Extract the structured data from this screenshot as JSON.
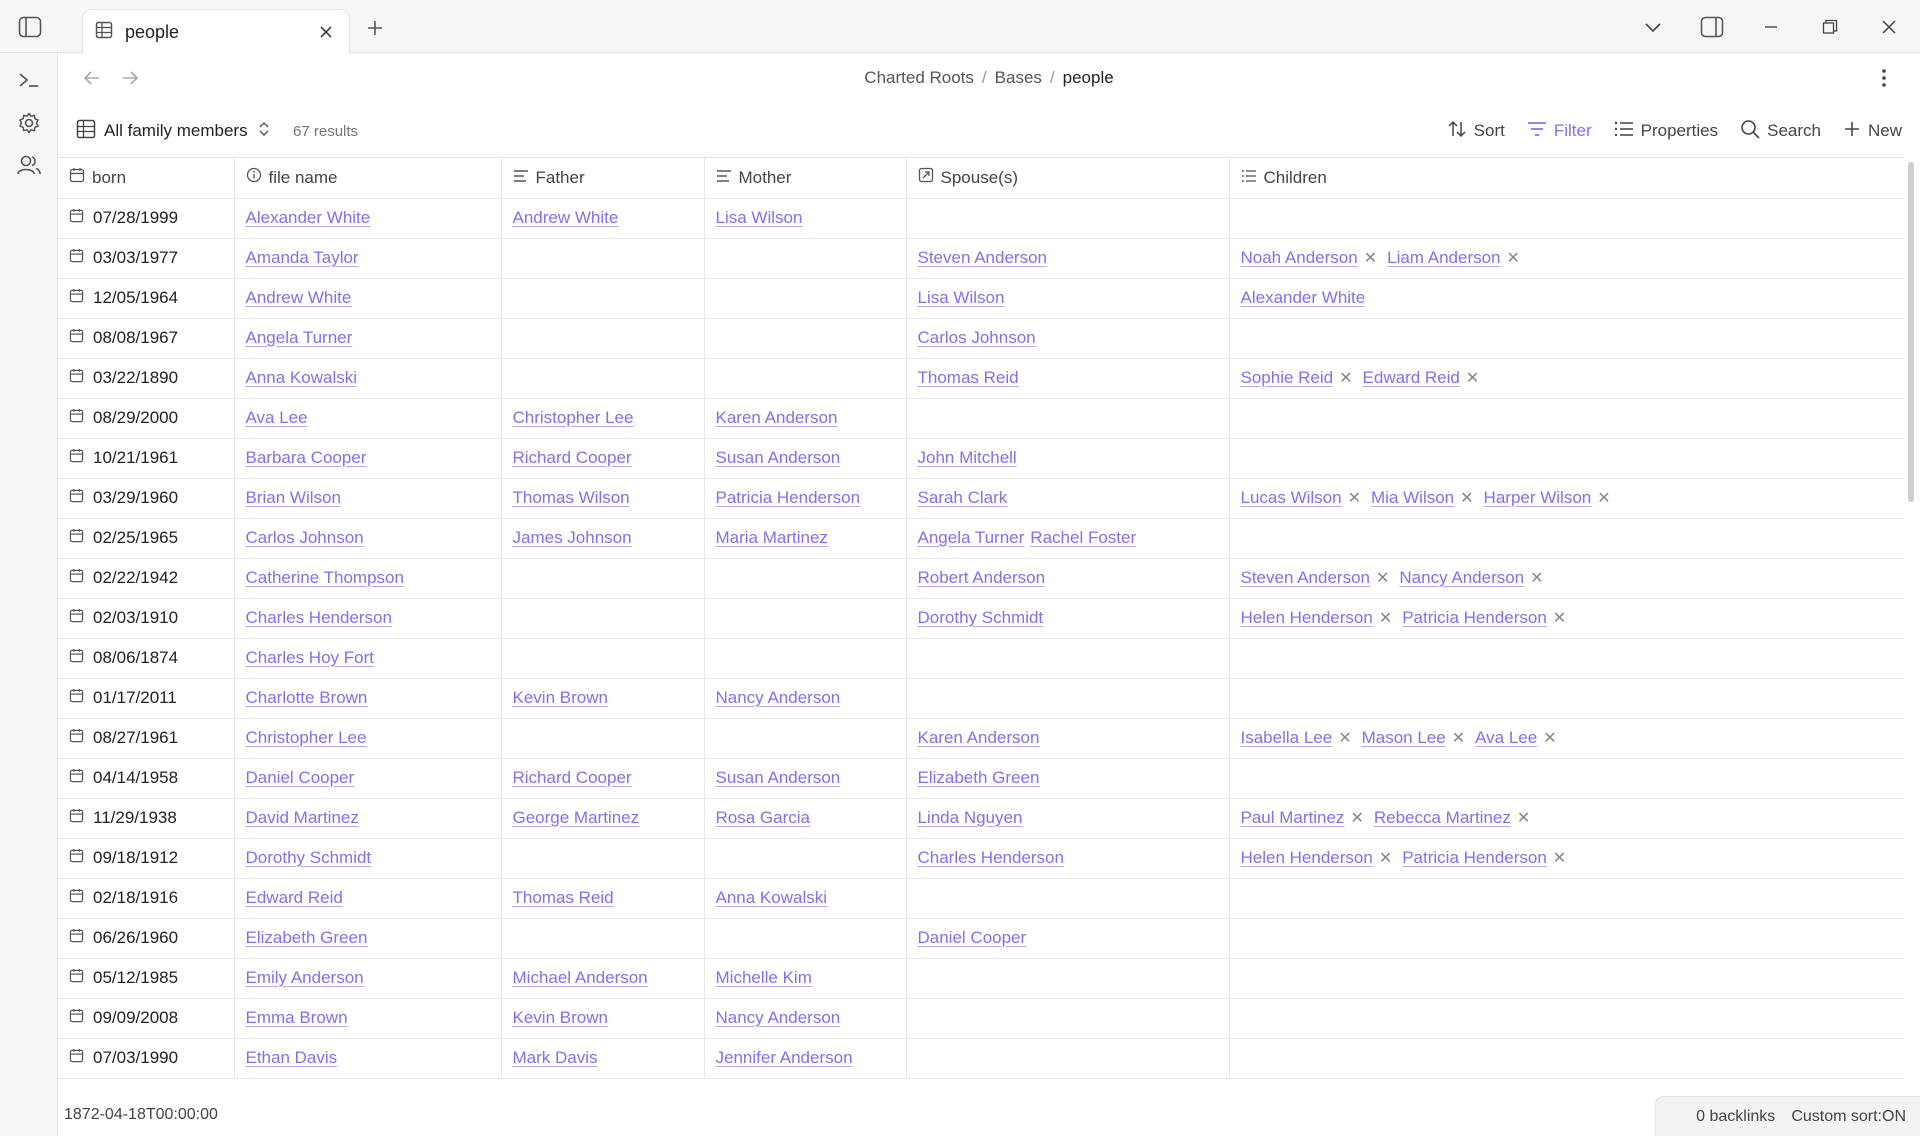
{
  "tab": {
    "label": "people"
  },
  "breadcrumb": {
    "items": [
      "Charted Roots",
      "Bases"
    ],
    "current": "people"
  },
  "toolbar": {
    "view_label": "All family members",
    "result_count": "67 results",
    "sort": "Sort",
    "filter": "Filter",
    "properties": "Properties",
    "search": "Search",
    "new": "New"
  },
  "columns": {
    "born": "born",
    "file_name": "file name",
    "father": "Father",
    "mother": "Mother",
    "spouses": "Spouse(s)",
    "children": "Children"
  },
  "rows": [
    {
      "born": "07/28/1999",
      "name": "Alexander White",
      "father": "Andrew White",
      "mother": "Lisa Wilson",
      "spouses": [],
      "children": []
    },
    {
      "born": "03/03/1977",
      "name": "Amanda Taylor",
      "father": "",
      "mother": "",
      "spouses": [
        "Steven Anderson"
      ],
      "children": [
        "Noah Anderson",
        "Liam Anderson"
      ]
    },
    {
      "born": "12/05/1964",
      "name": "Andrew White",
      "father": "",
      "mother": "",
      "spouses": [
        "Lisa Wilson"
      ],
      "children": [
        "Alexander White"
      ],
      "children_plain": true
    },
    {
      "born": "08/08/1967",
      "name": "Angela Turner",
      "father": "",
      "mother": "",
      "spouses": [
        "Carlos Johnson"
      ],
      "children": []
    },
    {
      "born": "03/22/1890",
      "name": "Anna Kowalski",
      "father": "",
      "mother": "",
      "spouses": [
        "Thomas Reid"
      ],
      "children": [
        "Sophie Reid",
        "Edward Reid"
      ]
    },
    {
      "born": "08/29/2000",
      "name": "Ava Lee",
      "father": "Christopher Lee",
      "mother": "Karen Anderson",
      "spouses": [],
      "children": []
    },
    {
      "born": "10/21/1961",
      "name": "Barbara Cooper",
      "father": "Richard Cooper",
      "mother": "Susan Anderson",
      "spouses": [
        "John Mitchell"
      ],
      "children": []
    },
    {
      "born": "03/29/1960",
      "name": "Brian Wilson",
      "father": "Thomas Wilson",
      "mother": "Patricia Henderson",
      "spouses": [
        "Sarah Clark"
      ],
      "children": [
        "Lucas Wilson",
        "Mia Wilson",
        "Harper Wilson"
      ]
    },
    {
      "born": "02/25/1965",
      "name": "Carlos Johnson",
      "father": "James Johnson",
      "mother": "Maria Martinez",
      "spouses": [
        "Angela Turner",
        "Rachel Foster"
      ],
      "children": []
    },
    {
      "born": "02/22/1942",
      "name": "Catherine Thompson",
      "father": "",
      "mother": "",
      "spouses": [
        "Robert Anderson"
      ],
      "children": [
        "Steven Anderson",
        "Nancy Anderson"
      ]
    },
    {
      "born": "02/03/1910",
      "name": "Charles Henderson",
      "father": "",
      "mother": "",
      "spouses": [
        "Dorothy Schmidt"
      ],
      "children": [
        "Helen Henderson",
        "Patricia Henderson"
      ]
    },
    {
      "born": "08/06/1874",
      "name": "Charles Hoy Fort",
      "father": "",
      "mother": "",
      "spouses": [],
      "children": []
    },
    {
      "born": "01/17/2011",
      "name": "Charlotte Brown",
      "father": "Kevin Brown",
      "mother": "Nancy Anderson",
      "spouses": [],
      "children": []
    },
    {
      "born": "08/27/1961",
      "name": "Christopher Lee",
      "father": "",
      "mother": "",
      "spouses": [
        "Karen Anderson"
      ],
      "children": [
        "Isabella Lee",
        "Mason Lee",
        "Ava Lee"
      ]
    },
    {
      "born": "04/14/1958",
      "name": "Daniel Cooper",
      "father": "Richard Cooper",
      "mother": "Susan Anderson",
      "spouses": [
        "Elizabeth Green"
      ],
      "children": []
    },
    {
      "born": "11/29/1938",
      "name": "David Martinez",
      "father": "George Martinez",
      "mother": "Rosa Garcia",
      "spouses": [
        "Linda Nguyen"
      ],
      "children": [
        "Paul Martinez",
        "Rebecca Martinez"
      ]
    },
    {
      "born": "09/18/1912",
      "name": "Dorothy Schmidt",
      "father": "",
      "mother": "",
      "spouses": [
        "Charles Henderson"
      ],
      "children": [
        "Helen Henderson",
        "Patricia Henderson"
      ]
    },
    {
      "born": "02/18/1916",
      "name": "Edward Reid",
      "father": "Thomas Reid",
      "mother": "Anna Kowalski",
      "spouses": [],
      "children": []
    },
    {
      "born": "06/26/1960",
      "name": "Elizabeth Green",
      "father": "",
      "mother": "",
      "spouses": [
        "Daniel Cooper"
      ],
      "children": []
    },
    {
      "born": "05/12/1985",
      "name": "Emily Anderson",
      "father": "Michael Anderson",
      "mother": "Michelle Kim",
      "spouses": [],
      "children": []
    },
    {
      "born": "09/09/2008",
      "name": "Emma Brown",
      "father": "Kevin Brown",
      "mother": "Nancy Anderson",
      "spouses": [],
      "children": []
    },
    {
      "born": "07/03/1990",
      "name": "Ethan Davis",
      "father": "Mark Davis",
      "mother": "Jennifer Anderson",
      "spouses": [],
      "children": []
    }
  ],
  "footer": {
    "value": "1872-04-18T00:00:00",
    "backlinks": "0 backlinks",
    "sort_status": "Custom sort:ON"
  },
  "colors": {
    "accent": "#8a6cf0"
  }
}
